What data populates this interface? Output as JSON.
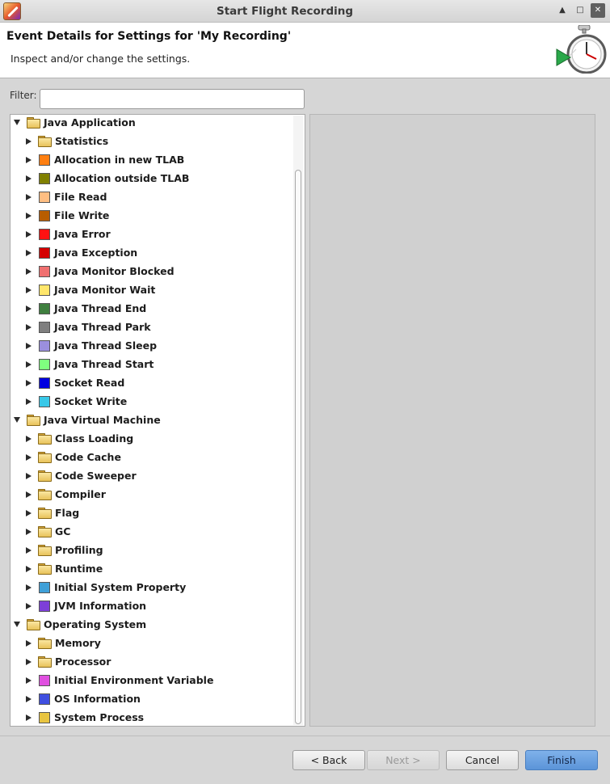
{
  "window": {
    "title": "Start Flight Recording",
    "buttons": [
      "up-icon",
      "restore-icon",
      "close-icon"
    ]
  },
  "header": {
    "title": "Event Details for Settings for 'My Recording'",
    "description": "Inspect and/or change the settings."
  },
  "filter": {
    "label": "Filter:",
    "value": "",
    "placeholder": ""
  },
  "tree": [
    {
      "label": "Java Application",
      "level": 0,
      "kind": "folder",
      "expanded": true
    },
    {
      "label": "Statistics",
      "level": 1,
      "kind": "folder",
      "expanded": false
    },
    {
      "label": "Allocation in new TLAB",
      "level": 1,
      "kind": "event",
      "color": "#ff7f11"
    },
    {
      "label": "Allocation outside TLAB",
      "level": 1,
      "kind": "event",
      "color": "#808000"
    },
    {
      "label": "File Read",
      "level": 1,
      "kind": "event",
      "color": "#ffbe82"
    },
    {
      "label": "File Write",
      "level": 1,
      "kind": "event",
      "color": "#b85d00"
    },
    {
      "label": "Java Error",
      "level": 1,
      "kind": "event",
      "color": "#ff1212"
    },
    {
      "label": "Java Exception",
      "level": 1,
      "kind": "event",
      "color": "#d40000"
    },
    {
      "label": "Java Monitor Blocked",
      "level": 1,
      "kind": "event",
      "color": "#f07070"
    },
    {
      "label": "Java Monitor Wait",
      "level": 1,
      "kind": "event",
      "color": "#ffe66b"
    },
    {
      "label": "Java Thread End",
      "level": 1,
      "kind": "event",
      "color": "#3f7f3f"
    },
    {
      "label": "Java Thread Park",
      "level": 1,
      "kind": "event",
      "color": "#7f7f7f"
    },
    {
      "label": "Java Thread Sleep",
      "level": 1,
      "kind": "event",
      "color": "#9b8fde"
    },
    {
      "label": "Java Thread Start",
      "level": 1,
      "kind": "event",
      "color": "#7fff7f"
    },
    {
      "label": "Socket Read",
      "level": 1,
      "kind": "event",
      "color": "#0000e0"
    },
    {
      "label": "Socket Write",
      "level": 1,
      "kind": "event",
      "color": "#38c8e8"
    },
    {
      "label": "Java Virtual Machine",
      "level": 0,
      "kind": "folder",
      "expanded": true
    },
    {
      "label": "Class Loading",
      "level": 1,
      "kind": "folder",
      "expanded": false
    },
    {
      "label": "Code Cache",
      "level": 1,
      "kind": "folder",
      "expanded": false
    },
    {
      "label": "Code Sweeper",
      "level": 1,
      "kind": "folder",
      "expanded": false
    },
    {
      "label": "Compiler",
      "level": 1,
      "kind": "folder",
      "expanded": false
    },
    {
      "label": "Flag",
      "level": 1,
      "kind": "folder",
      "expanded": false
    },
    {
      "label": "GC",
      "level": 1,
      "kind": "folder",
      "expanded": false
    },
    {
      "label": "Profiling",
      "level": 1,
      "kind": "folder",
      "expanded": false
    },
    {
      "label": "Runtime",
      "level": 1,
      "kind": "folder",
      "expanded": false
    },
    {
      "label": "Initial System Property",
      "level": 1,
      "kind": "event",
      "color": "#3fa0d8"
    },
    {
      "label": "JVM Information",
      "level": 1,
      "kind": "event",
      "color": "#7d3fd8"
    },
    {
      "label": "Operating System",
      "level": 0,
      "kind": "folder",
      "expanded": true
    },
    {
      "label": "Memory",
      "level": 1,
      "kind": "folder",
      "expanded": false
    },
    {
      "label": "Processor",
      "level": 1,
      "kind": "folder",
      "expanded": false
    },
    {
      "label": "Initial Environment Variable",
      "level": 1,
      "kind": "event",
      "color": "#e04fe0"
    },
    {
      "label": "OS Information",
      "level": 1,
      "kind": "event",
      "color": "#3f4fe0"
    },
    {
      "label": "System Process",
      "level": 1,
      "kind": "event",
      "color": "#e8c440"
    }
  ],
  "buttons": {
    "back": "< Back",
    "next": "Next >",
    "cancel": "Cancel",
    "finish": "Finish"
  },
  "colors": {
    "accent": "#6aa0e0",
    "background": "#d6d6d6"
  }
}
